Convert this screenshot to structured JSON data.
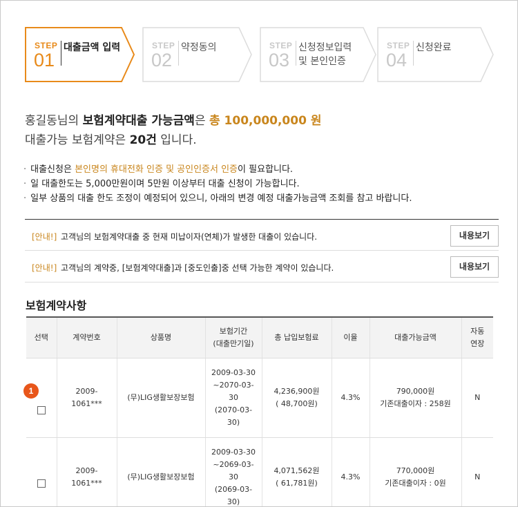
{
  "steps": [
    {
      "label": "STEP",
      "num": "01",
      "title": "대출금액 입력",
      "active": true
    },
    {
      "label": "STEP",
      "num": "02",
      "title": "약정동의",
      "active": false
    },
    {
      "label": "STEP",
      "num": "03",
      "title": "신청정보입력\n및 본인인증",
      "active": false
    },
    {
      "label": "STEP",
      "num": "04",
      "title": "신청완료",
      "active": false
    }
  ],
  "summary": {
    "name": "홍길동님의 ",
    "bold1": "보험계약대출 가능금액",
    "mid": "은 ",
    "amount": "총 100,000,000 원",
    "line2_pre": "대출가능 보험계약은 ",
    "count": "20건",
    "line2_post": " 입니다."
  },
  "bullets": {
    "b1_pre": "대출신청은 ",
    "b1_hl": "본인명의 휴대전화 인증 및 공인인증서 인증",
    "b1_post": "이 필요합니다.",
    "b2": "일 대출한도는 5,000만원이며 5만원 이상부터 대출 신청이 가능합니다.",
    "b3": "일부 상품의 대출 한도 조정이 예정되어 있으니, 아래의 변경 예정 대출가능금액 조회를 참고 바랍니다."
  },
  "notices": [
    {
      "tag": "[안내!]",
      "msg": "고객님의 보험계약대출 중 현재 미납이자(연체)가 발생한 대출이 있습니다.",
      "button": "내용보기"
    },
    {
      "tag": "[안내!]",
      "msg": "고객님의 계약중, [보험계약대출]과 [중도인출]중 선택 가능한 계약이 있습니다.",
      "button": "내용보기"
    }
  ],
  "section_title": "보험계약사항",
  "table": {
    "headers": [
      "선택",
      "계약번호",
      "상품명",
      "보험기간\n(대출만기일)",
      "총 납입보험료",
      "이율",
      "대출가능금액",
      "자동\n연장"
    ],
    "rows": [
      {
        "contract": "2009-\n1061***",
        "product": "(무)LIG생활보장보험",
        "period": "2009-03-30\n~2070-03-\n30\n(2070-03-\n30)",
        "premium": "4,236,900원\n( 48,700원)",
        "rate": "4.3%",
        "loan": "790,000원\n기존대출이자 : 258원",
        "auto": "N"
      },
      {
        "contract": "2009-\n1061***",
        "product": "(무)LIG생활보장보험",
        "period": "2009-03-30\n~2069-03-\n30\n(2069-03-\n30)",
        "premium": "4,071,562원\n( 61,781원)",
        "rate": "4.3%",
        "loan": "770,000원\n기존대출이자 : 0원",
        "auto": "N"
      }
    ]
  },
  "marker": "1",
  "colors": {
    "accent": "#e88a1a",
    "highlight": "#c9861d",
    "marker": "#e8561a"
  }
}
